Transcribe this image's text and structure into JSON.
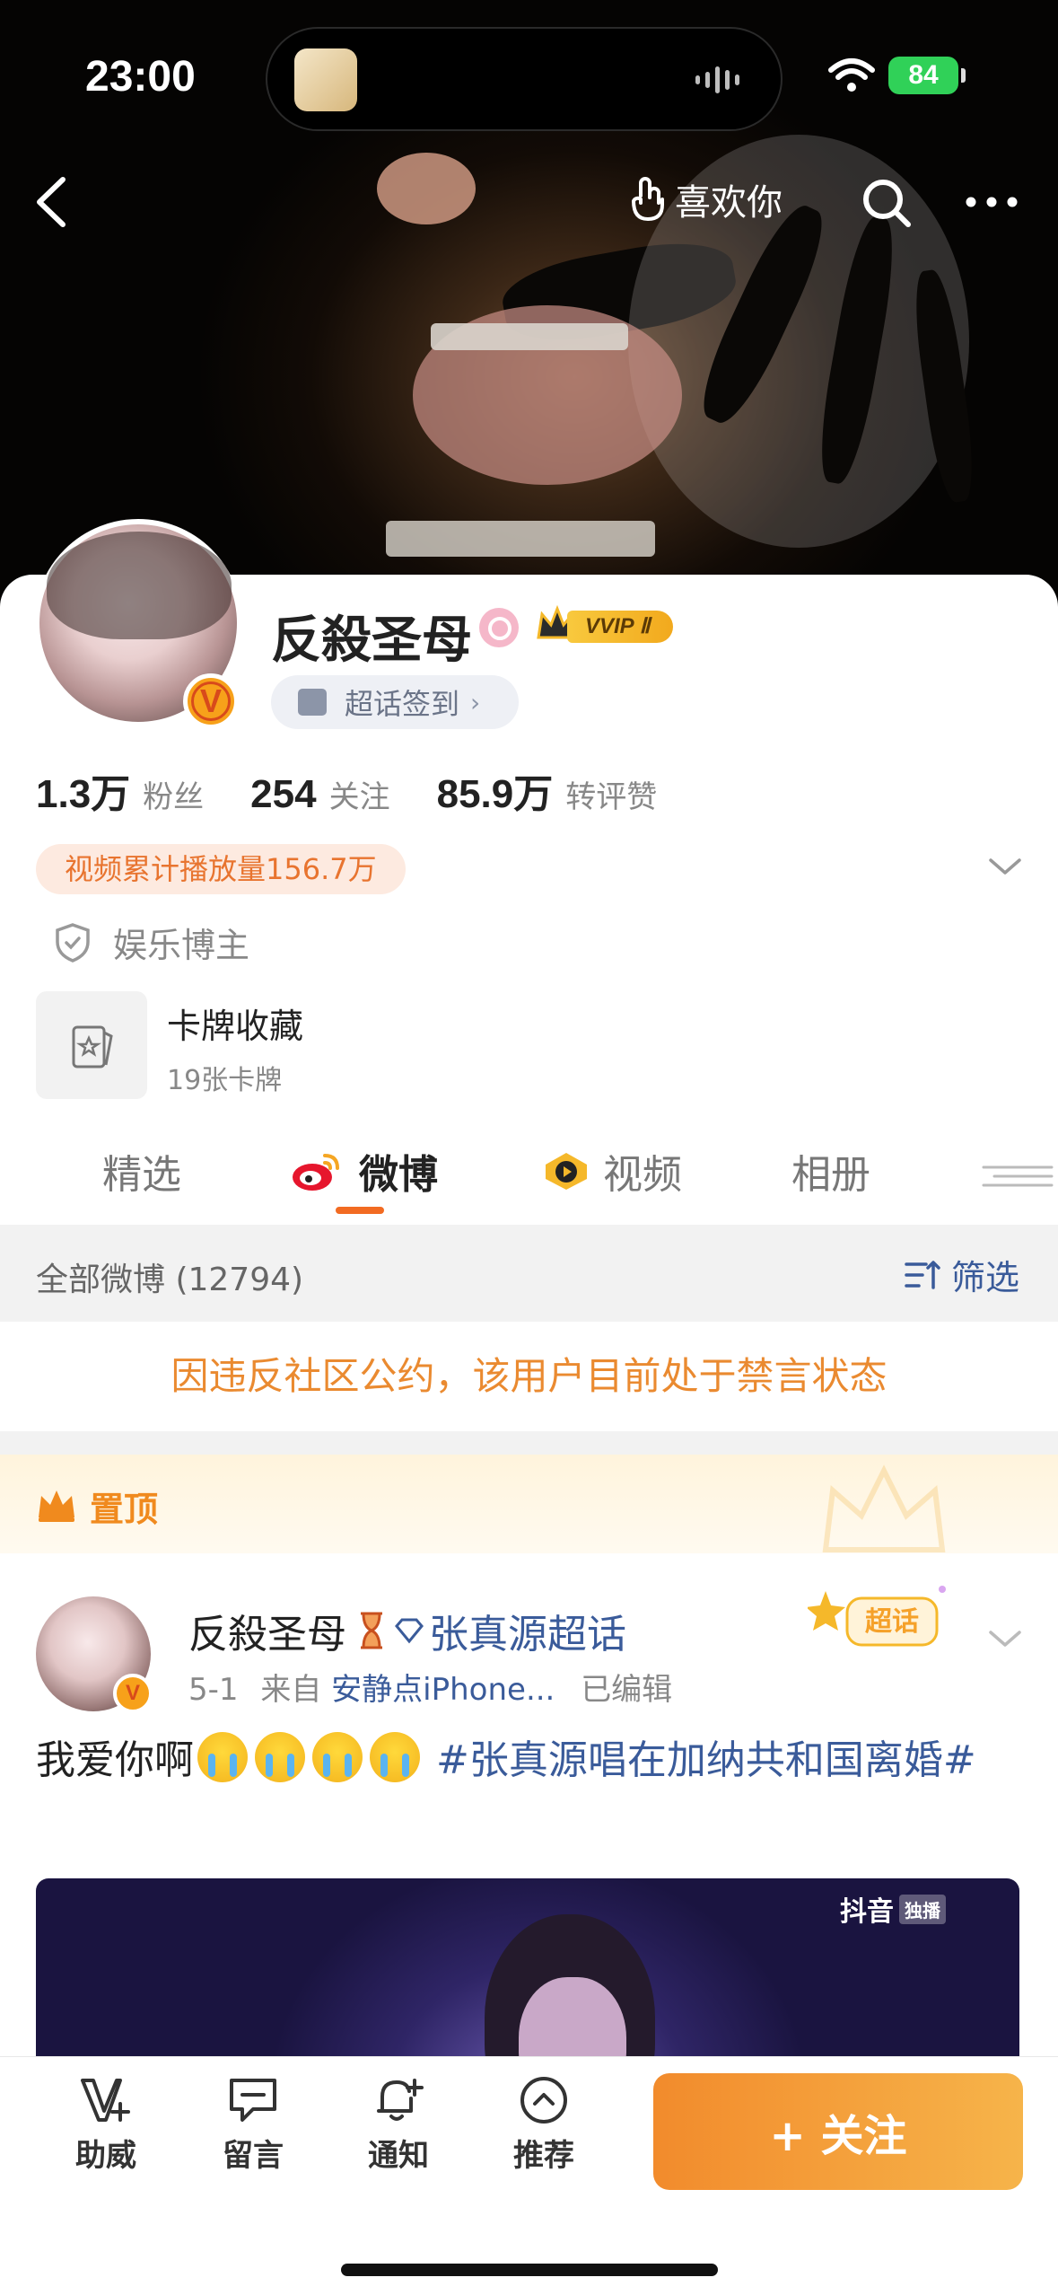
{
  "status_bar": {
    "time": "23:00",
    "battery": "84"
  },
  "header": {
    "like_label": "喜欢你"
  },
  "profile": {
    "name": "反殺圣母",
    "vip_label": "VVIP Ⅱ",
    "supertopic_checkin": "超话签到",
    "stats": [
      {
        "num": "1.3万",
        "label": "粉丝"
      },
      {
        "num": "254",
        "label": "关注"
      },
      {
        "num": "85.9万",
        "label": "转评赞"
      }
    ],
    "video_plays": "视频累计播放量156.7万",
    "creator_tag": "娱乐博主",
    "cards": {
      "title": "卡牌收藏",
      "sub": "19张卡牌"
    }
  },
  "tabs": [
    {
      "label": "精选"
    },
    {
      "label": "微博",
      "active": true
    },
    {
      "label": "视频"
    },
    {
      "label": "相册"
    }
  ],
  "feed": {
    "all_label": "全部微博 (12794)",
    "filter_label": "筛选",
    "ban_notice": "因违反社区公约，该用户目前处于禁言状态",
    "pinned_label": "置顶",
    "post": {
      "name": "反殺圣母",
      "topic": "张真源超话",
      "supertag": "超话",
      "date": "5-1",
      "from_prefix": "来自",
      "source": "安静点iPhone...",
      "edited": "已编辑",
      "text": "我爱你啊",
      "hashtag": "#张真源唱在加纳共和国离婚#",
      "media_watermark": "抖音",
      "media_badge": "独播"
    }
  },
  "bottom_bar": {
    "items": [
      {
        "label": "助威",
        "icon": "cheer-icon"
      },
      {
        "label": "留言",
        "icon": "message-icon"
      },
      {
        "label": "通知",
        "icon": "bell-icon"
      },
      {
        "label": "推荐",
        "icon": "recommend-icon"
      }
    ],
    "follow_label": "+ 关注"
  },
  "colors": {
    "accent": "#f26b22",
    "link": "#3a5b9a",
    "warning": "#ea8a30",
    "follow_gradient_start": "#f28b2c",
    "follow_gradient_end": "#f6b44a"
  }
}
